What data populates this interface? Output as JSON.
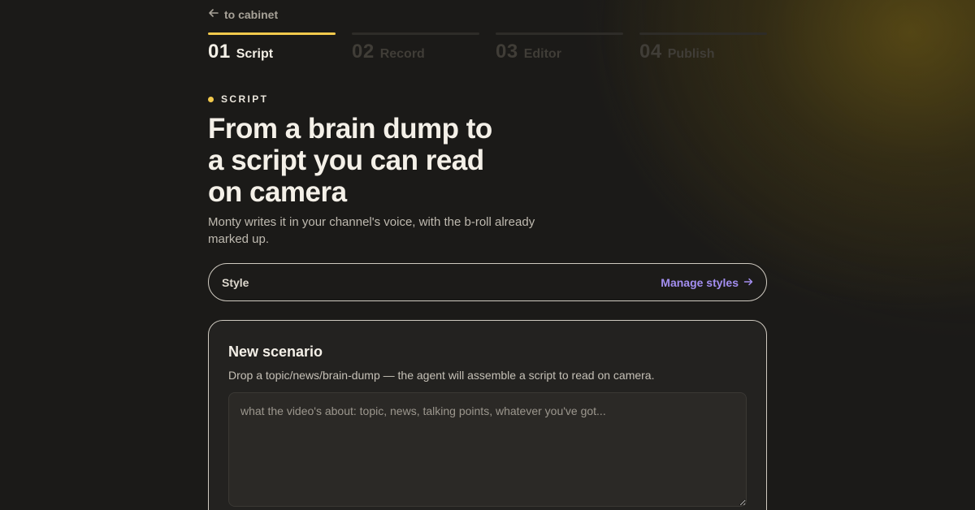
{
  "nav": {
    "back_label": "to cabinet"
  },
  "steps": [
    {
      "num": "01",
      "name": "Script",
      "active": true
    },
    {
      "num": "02",
      "name": "Record",
      "active": false
    },
    {
      "num": "03",
      "name": "Editor",
      "active": false
    },
    {
      "num": "04",
      "name": "Publish",
      "active": false
    }
  ],
  "hero": {
    "eyebrow": "SCRIPT",
    "title": "From a brain dump to a script you can read on camera",
    "subtitle": "Monty writes it in your channel's voice, with the b-roll already marked up."
  },
  "style_bar": {
    "label": "Style",
    "manage_label": "Manage styles"
  },
  "scenario": {
    "title": "New scenario",
    "description": "Drop a topic/news/brain-dump — the agent will assemble a script to read on camera.",
    "input_value": "",
    "input_placeholder": "what the video's about: topic, news, talking points, whatever you've got..."
  },
  "colors": {
    "accent": "#f2c94c",
    "link": "#a38ef0",
    "background": "#1b1a18"
  },
  "icons": {
    "back": "arrow-left-icon",
    "manage": "arrow-right-icon"
  }
}
